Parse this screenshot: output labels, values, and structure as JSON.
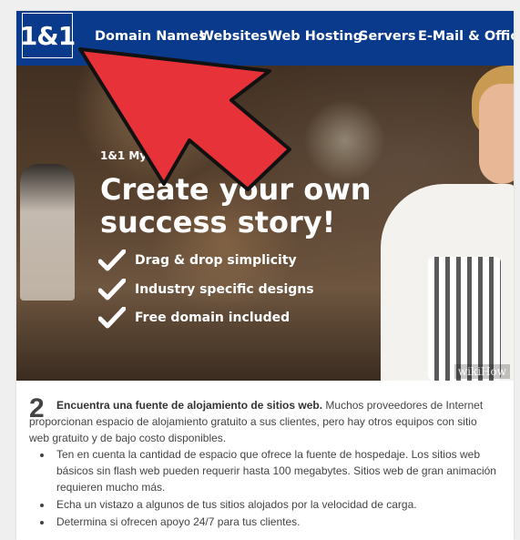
{
  "screenshot": {
    "logo": "1&1",
    "nav_items": [
      "Domain Names",
      "Websites",
      "Web Hosting",
      "Servers",
      "E-Mail & Office"
    ],
    "tagline": "1&1 MyWe",
    "headline": "Create your own success story!",
    "features": [
      "Drag & drop simplicity",
      "Industry specific designs",
      "Free domain included"
    ],
    "watermark": "wikiHow"
  },
  "step": {
    "number": "2",
    "title": "Encuentra una fuente de alojamiento de sitios web.",
    "body": " Muchos proveedores de Internet proporcionan espacio de alojamiento gratuito a sus clientes, pero hay otros equipos con sitio web gratuito y de bajo costo disponibles.",
    "bullets": [
      "Ten en cuenta la cantidad de espacio que ofrece la fuente de hospedaje. Los sitios web básicos sin flash web pueden requerir hasta 100 megabytes. Sitios web de gran animación requieren mucho más.",
      "Echa un vistazo a algunos de tus sitios alojados por la velocidad de carga.",
      "Determina si ofrecen apoyo 24/7 para tus clientes."
    ]
  },
  "colors": {
    "nav_blue": "#0a3a8c",
    "arrow_red": "#e8323a",
    "text_gray": "#444444"
  }
}
